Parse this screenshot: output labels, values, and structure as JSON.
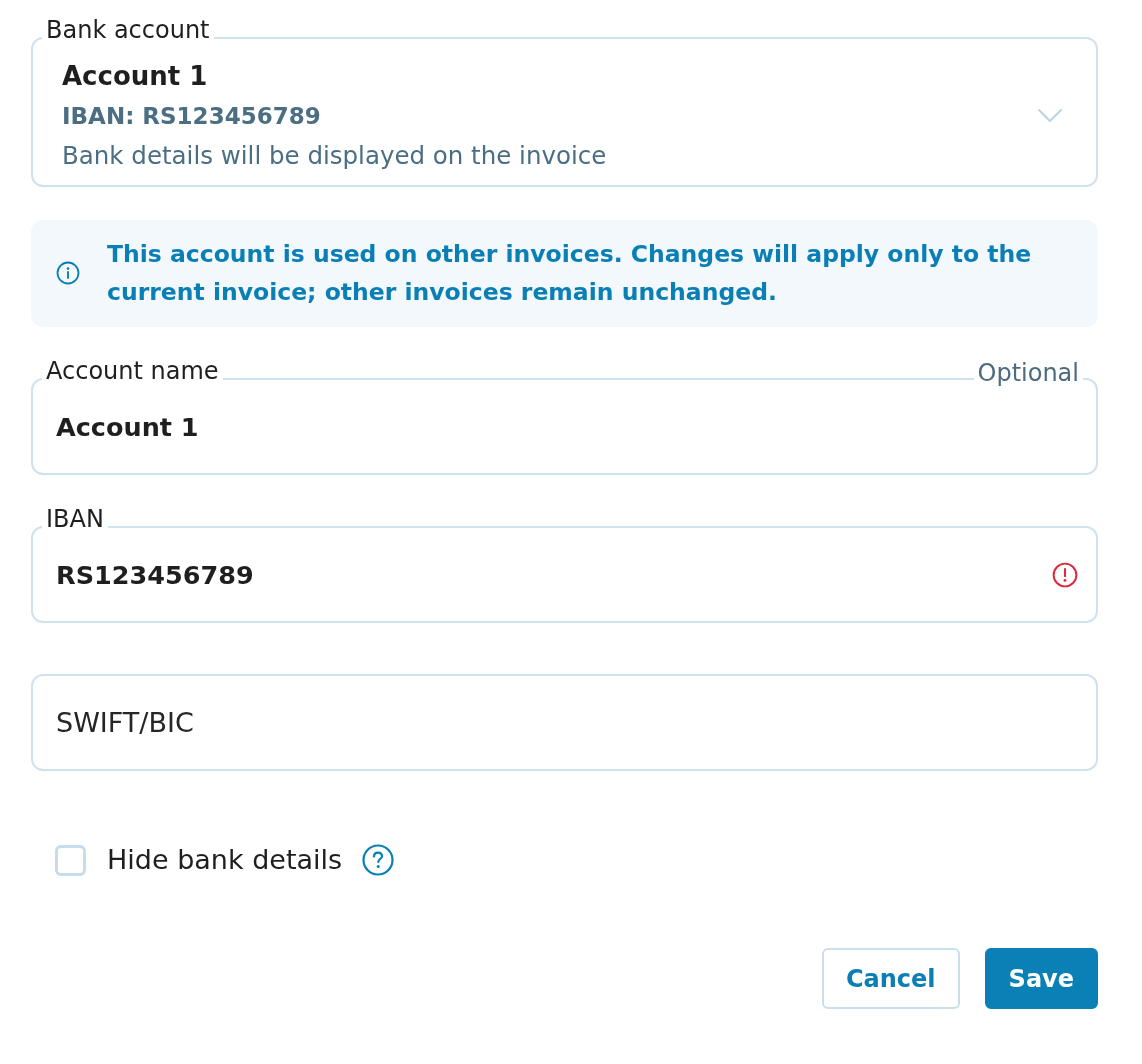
{
  "bank_account_select": {
    "label": "Bank account",
    "account": "Account 1",
    "iban": "IBAN: RS123456789",
    "note": "Bank details will be displayed on the invoice"
  },
  "notice": {
    "kind": "info",
    "text": "This account is used on other invoices. Changes will apply only to the current invoice; other invoices remain unchanged."
  },
  "fields": [
    {
      "label": "Account name",
      "hint": "Optional",
      "value": "Account 1",
      "invalid": false
    },
    {
      "label": "IBAN",
      "value": "RS123456789",
      "invalid": true
    },
    {
      "placeholder": "SWIFT/BIC",
      "invalid": false
    }
  ],
  "hide_bank_details": {
    "label": "Hide bank details",
    "checked": false
  },
  "buttons": [
    {
      "label": "Cancel",
      "kind": "secondary"
    },
    {
      "label": "Save",
      "kind": "primary"
    }
  ]
}
